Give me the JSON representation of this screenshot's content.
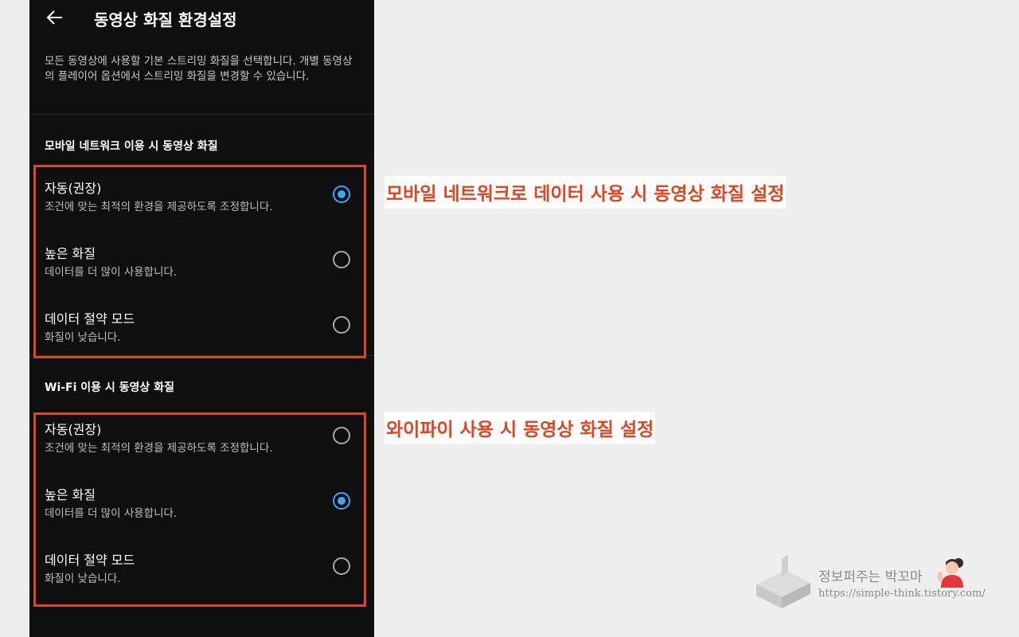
{
  "header": {
    "title": "동영상 화질 환경설정"
  },
  "description": "모든 동영상에 사용할 기본 스트리밍 화질을 선택합니다. 개별 동영상의 플레이어 옵션에서 스트리밍 화질을 변경할 수 있습니다.",
  "mobile_section": {
    "label": "모바일 네트워크 이용 시 동영상 화질",
    "options": [
      {
        "label": "자동(권장)",
        "sub": "조건에 맞는 최적의 환경을 제공하도록 조정합니다.",
        "selected": true
      },
      {
        "label": "높은 화질",
        "sub": "데이터를 더 많이 사용합니다.",
        "selected": false
      },
      {
        "label": "데이터 절약 모드",
        "sub": "화질이 낮습니다.",
        "selected": false
      }
    ]
  },
  "wifi_section": {
    "label": "Wi-Fi 이용 시 동영상 화질",
    "options": [
      {
        "label": "자동(권장)",
        "sub": "조건에 맞는 최적의 환경을 제공하도록 조정합니다.",
        "selected": false
      },
      {
        "label": "높은 화질",
        "sub": "데이터를 더 많이 사용합니다.",
        "selected": true
      },
      {
        "label": "데이터 절약 모드",
        "sub": "화질이 낮습니다.",
        "selected": false
      }
    ]
  },
  "annotations": {
    "mobile": "모바일 네트워크로 데이터 사용 시 동영상 화질 설정",
    "wifi": "와이파이 사용 시 동영상 화질 설정"
  },
  "watermark": {
    "name": "정보퍼주는 박꼬마",
    "url": "https://simple-think.tistory.com/"
  },
  "colors": {
    "accent": "#3ea6ff",
    "annotation": "#e04520",
    "background": "#0f0f0f"
  },
  "icons": {
    "back": "arrow-left-icon",
    "radio_on": "radio-selected-icon",
    "radio_off": "radio-unselected-icon"
  }
}
